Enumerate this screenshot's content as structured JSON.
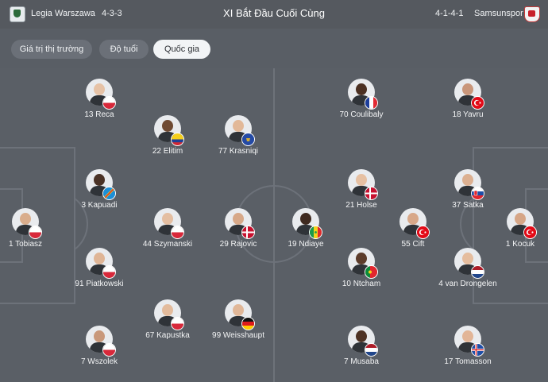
{
  "header": {
    "home_team": "Legia Warszawa",
    "home_formation": "4-3-3",
    "title": "XI Bắt Đầu Cuối Cùng",
    "away_formation": "4-1-4-1",
    "away_team": "Samsunspor"
  },
  "tabs": [
    {
      "label": "Giá trị thị trường",
      "active": false
    },
    {
      "label": "Độ tuổi",
      "active": false
    },
    {
      "label": "Quốc gia",
      "active": true
    }
  ],
  "colors": {
    "pitch": "#5a5f66",
    "pitch_lines": "#6d727a",
    "tab_active_bg": "#f2f4f6",
    "tab_bg": "#6b7078"
  },
  "home_players": [
    {
      "number": "13",
      "name": "Reca",
      "label": "13 Reca",
      "flag": "poland",
      "skin": "#e6c2a6"
    },
    {
      "number": "22",
      "name": "Elitim",
      "label": "22 Elitim",
      "flag": "colombia",
      "skin": "#6f4a33"
    },
    {
      "number": "77",
      "name": "Krasniqi",
      "label": "77 Krasniqi",
      "flag": "kosovo",
      "skin": "#e2b898"
    },
    {
      "number": "3",
      "name": "Kapuadi",
      "label": "3 Kapuadi",
      "flag": "dr-congo",
      "skin": "#4a3226"
    },
    {
      "number": "1",
      "name": "Tobiasz",
      "label": "1 Tobiasz",
      "flag": "poland",
      "skin": "#d9ad8c"
    },
    {
      "number": "44",
      "name": "Szymanski",
      "label": "44 Szymanski",
      "flag": "poland",
      "skin": "#e4bea1"
    },
    {
      "number": "29",
      "name": "Rajovic",
      "label": "29 Rajovic",
      "flag": "denmark",
      "skin": "#d7a888"
    },
    {
      "number": "91",
      "name": "Piatkowski",
      "label": "91 Piatkowski",
      "flag": "poland",
      "skin": "#dfb596"
    },
    {
      "number": "67",
      "name": "Kapustka",
      "label": "67 Kapustka",
      "flag": "poland",
      "skin": "#e3bb9c"
    },
    {
      "number": "99",
      "name": "Weisshaupt",
      "label": "99 Weisshaupt",
      "flag": "germany",
      "skin": "#e0b798"
    },
    {
      "number": "7",
      "name": "Wszolek",
      "label": "7 Wszolek",
      "flag": "poland",
      "skin": "#c9987a"
    }
  ],
  "away_players": [
    {
      "number": "70",
      "name": "Coulibaly",
      "label": "70 Coulibaly",
      "flag": "france",
      "skin": "#4b3022"
    },
    {
      "number": "18",
      "name": "Yavru",
      "label": "18 Yavru",
      "flag": "turkey",
      "skin": "#c9967a"
    },
    {
      "number": "21",
      "name": "Holse",
      "label": "21 Holse",
      "flag": "denmark",
      "skin": "#e6c0a2"
    },
    {
      "number": "37",
      "name": "Satka",
      "label": "37 Satka",
      "flag": "slovakia",
      "skin": "#dcb091"
    },
    {
      "number": "19",
      "name": "Ndiaye",
      "label": "19 Ndiaye",
      "flag": "senegal",
      "skin": "#3f2a20"
    },
    {
      "number": "55",
      "name": "Cift",
      "label": "55 Cift",
      "flag": "turkey",
      "skin": "#d8a889"
    },
    {
      "number": "1",
      "name": "Kocuk",
      "label": "1 Kocuk",
      "flag": "turkey",
      "skin": "#d6a687"
    },
    {
      "number": "10",
      "name": "Ntcham",
      "label": "10 Ntcham",
      "flag": "portugal",
      "skin": "#5c3c2b"
    },
    {
      "number": "4",
      "name": "van Drongelen",
      "label": "4 van Drongelen",
      "flag": "netherlands",
      "skin": "#e5bd9e"
    },
    {
      "number": "7",
      "name": "Musaba",
      "label": "7 Musaba",
      "flag": "netherlands",
      "skin": "#4d3224"
    },
    {
      "number": "17",
      "name": "Tomasson",
      "label": "17 Tomasson",
      "flag": "iceland",
      "skin": "#e2b597"
    }
  ]
}
